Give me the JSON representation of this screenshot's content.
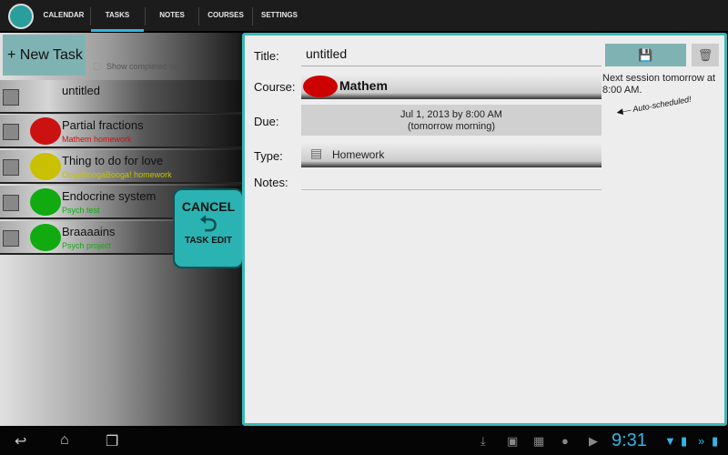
{
  "tabs": [
    "CALENDAR",
    "TASKS",
    "NOTES",
    "COURSES",
    "SETTINGS"
  ],
  "left": {
    "new_task": "+ New Task",
    "show_completed": "Show completed tasks",
    "tasks": [
      {
        "title": "untitled",
        "subtitle": "",
        "color": "#999999"
      },
      {
        "title": "Partial fractions",
        "subtitle": "Mathem homework",
        "color": "#cc1111"
      },
      {
        "title": "Thing to do for love",
        "subtitle": "OogaBoogaBooga! homework",
        "color": "#c8c000"
      },
      {
        "title": "Endocrine system",
        "subtitle": "Psych test",
        "color": "#11aa11"
      },
      {
        "title": "Braaaains",
        "subtitle": "Psych project",
        "color": "#11aa11"
      }
    ]
  },
  "cancel": {
    "top": "CANCEL",
    "bottom": "TASK EDIT",
    "icon": "undo-arrow-icon"
  },
  "form": {
    "title_label": "Title:",
    "title_value": "untitled",
    "course_label": "Course:",
    "course_value": "Mathem",
    "due_label": "Due:",
    "due_line1": "Jul 1, 2013 by 8:00 AM",
    "due_line2": "(tomorrow morning)",
    "type_label": "Type:",
    "type_value": "Homework",
    "notes_label": "Notes:",
    "next_session": "Next session tomorrow at 8:00 AM.",
    "auto": "Auto-scheduled!"
  },
  "status": {
    "time": "9:31"
  }
}
